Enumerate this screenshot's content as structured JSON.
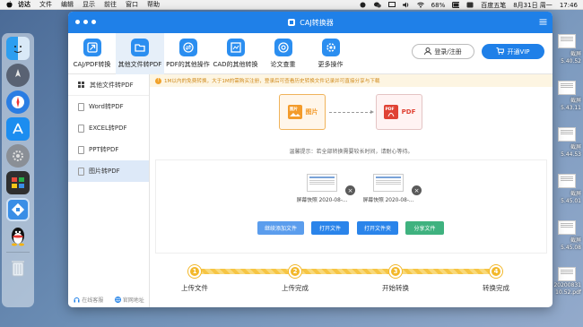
{
  "menubar": {
    "app_name": "访达",
    "items": [
      "文件",
      "编辑",
      "显示",
      "前往",
      "窗口",
      "帮助"
    ],
    "battery": "68%",
    "input_method": "百度五笔",
    "datetime": "8月31日 周一",
    "time": "17:46"
  },
  "desktop_files": [
    {
      "label": "截屏"
    },
    {
      "label": "5.40.52"
    },
    {
      "label": "截屏"
    },
    {
      "label": "5.43.11"
    },
    {
      "label": "截屏"
    },
    {
      "label": "5.44.53"
    },
    {
      "label": "截屏"
    },
    {
      "label": "5.45.01"
    },
    {
      "label": "截屏"
    },
    {
      "label": "5.45.08"
    },
    {
      "label": "20200831"
    },
    {
      "label": "10.52.pdf"
    }
  ],
  "window": {
    "title": "CAJ转换器",
    "toolbar": [
      {
        "label": "CAJ/PDF转换"
      },
      {
        "label": "其他文件转PDF"
      },
      {
        "label": "PDF的其他操作"
      },
      {
        "label": "CAD的其他转换"
      },
      {
        "label": "论文查重"
      },
      {
        "label": "更多操作"
      }
    ],
    "login_label": "登录/注册",
    "vip_label": "开通VIP",
    "sidebar": {
      "header": "其他文件转PDF",
      "items": [
        {
          "label": "Word转PDF"
        },
        {
          "label": "EXCEL转PDF"
        },
        {
          "label": "PPT转PDF"
        },
        {
          "label": "图片转PDF"
        }
      ],
      "footer_service": "在线客服",
      "footer_site": "官网地址"
    },
    "notice": "1M以内的免费转换，大于1M的需购买注册，登录后可查看历史转换文件记录并可直接分享与下载",
    "convert": {
      "from_label": "图片",
      "to_label": "PDF",
      "pdf_badge": "PDF",
      "img_badge": "图片"
    },
    "tip": "温馨提示：若全部转换需要较长时间，请耐心等待。",
    "files": [
      {
        "name": "屏幕快照 2020-08-..."
      },
      {
        "name": "屏幕快照 2020-08-..."
      }
    ],
    "actions": {
      "add": "继续添加文件",
      "open_file": "打开文件",
      "open_folder": "打开文件夹",
      "share": "分享文件"
    },
    "steps": [
      {
        "num": "1",
        "label": "上传文件"
      },
      {
        "num": "2",
        "label": "上传完成"
      },
      {
        "num": "3",
        "label": "开始转换"
      },
      {
        "num": "4",
        "label": "转换完成"
      }
    ]
  },
  "colors": {
    "brand_blue": "#1f80e8",
    "step_yellow": "#f3b82a",
    "btn_add": "#5b9ded",
    "btn_blue": "#2a84ea",
    "btn_share": "#3fb27f"
  }
}
